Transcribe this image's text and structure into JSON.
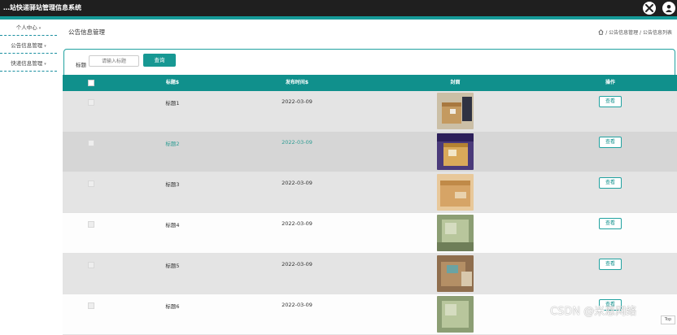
{
  "app": {
    "title": "…站快递驿站管理信息系统"
  },
  "sidebar": {
    "items": [
      {
        "label": "个人中心"
      },
      {
        "label": "公告信息管理"
      },
      {
        "label": "快递信息管理"
      }
    ]
  },
  "page": {
    "title": "公告信息管理",
    "breadcrumb": [
      "公告信息管理",
      "公告信息列表"
    ]
  },
  "search": {
    "label": "标题",
    "placeholder": "请输入标题",
    "button": "查询"
  },
  "table": {
    "columns": [
      "标题$",
      "发布时间$",
      "封面",
      "操作"
    ],
    "rows": [
      {
        "title": "标题1",
        "date": "2022-03-09",
        "action": "查看"
      },
      {
        "title": "标题2",
        "date": "2022-03-09",
        "action": "查看"
      },
      {
        "title": "标题3",
        "date": "2022-03-09",
        "action": "查看"
      },
      {
        "title": "标题4",
        "date": "2022-03-09",
        "action": "查看"
      },
      {
        "title": "标题5",
        "date": "2022-03-09",
        "action": "查看"
      },
      {
        "title": "标题6",
        "date": "2022-03-09",
        "action": "查看"
      }
    ]
  },
  "watermark": "CSDN @米恩网络",
  "scroll_top": "Top",
  "colors": {
    "accent": "#159a98",
    "header": "#10908c",
    "topbar": "#1f1f1f"
  }
}
